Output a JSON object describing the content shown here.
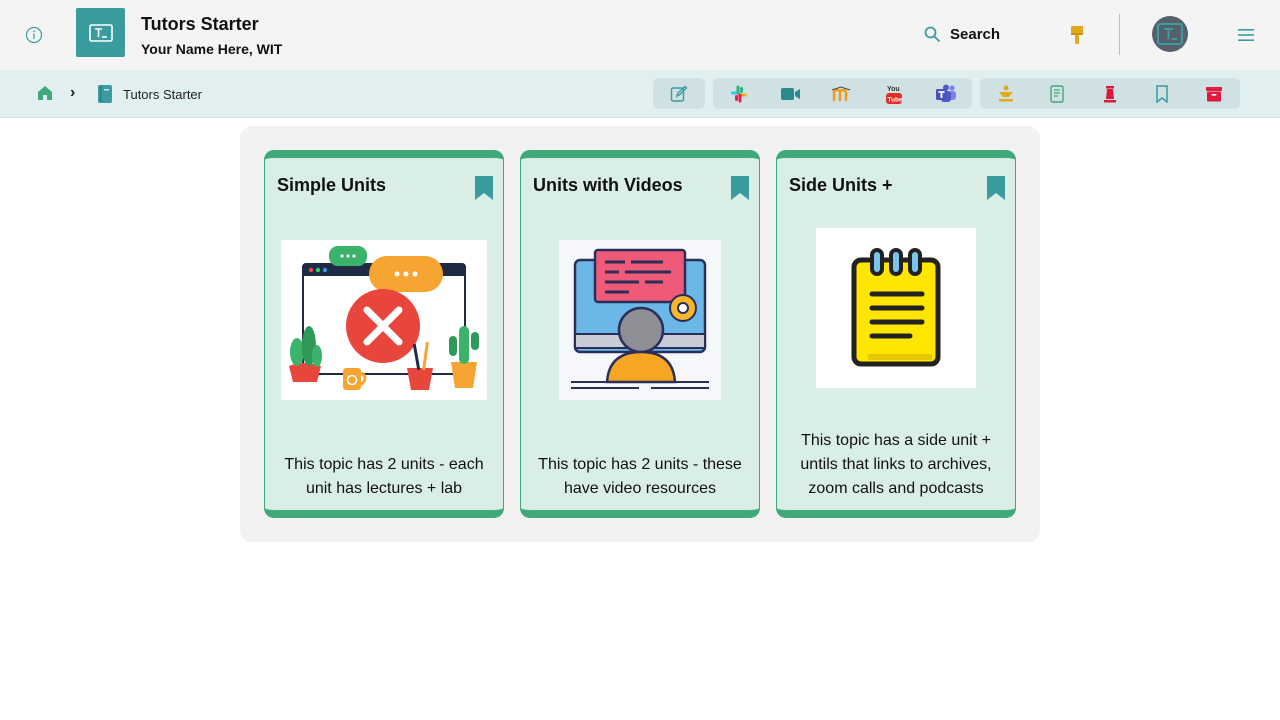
{
  "header": {
    "title": "Tutors Starter",
    "subtitle": "Your Name Here, WIT",
    "search_label": "Search",
    "icons": {
      "info": "info-circle-icon",
      "logo": "tutors-logo-icon",
      "search": "search-icon",
      "theme": "paintbrush-icon",
      "avatar": "avatar-icon",
      "menu": "hamburger-menu-icon"
    }
  },
  "breadcrumb": {
    "items": [
      {
        "icon": "home-icon"
      },
      {
        "icon": "book-icon",
        "label": "Tutors Starter"
      }
    ],
    "separator": "›"
  },
  "toolbar": {
    "edit": [
      "edit-icon"
    ],
    "comms": [
      "slack-icon",
      "video-icon",
      "moodle-icon",
      "youtube-icon",
      "teams-icon"
    ],
    "nav": [
      "companion-icon",
      "notes-icon",
      "lab-icon",
      "bookmark-icon",
      "archive-icon"
    ]
  },
  "cards": [
    {
      "title": "Simple Units",
      "description": "This topic has 2 units - each unit has lectures + lab",
      "image": "error-browser-illustration"
    },
    {
      "title": "Units with Videos",
      "description": "This topic has 2 units - these have video resources",
      "image": "computer-user-illustration"
    },
    {
      "title": "Side Units +",
      "description": "This topic has a side unit + untils that links to archives, zoom calls and podcasts",
      "image": "notepad-illustration"
    }
  ],
  "colors": {
    "brand": "#3a9c9f",
    "card_border": "#3fa97c",
    "card_bg": "#d9efe5",
    "subbar_bg": "#e1eff0"
  }
}
